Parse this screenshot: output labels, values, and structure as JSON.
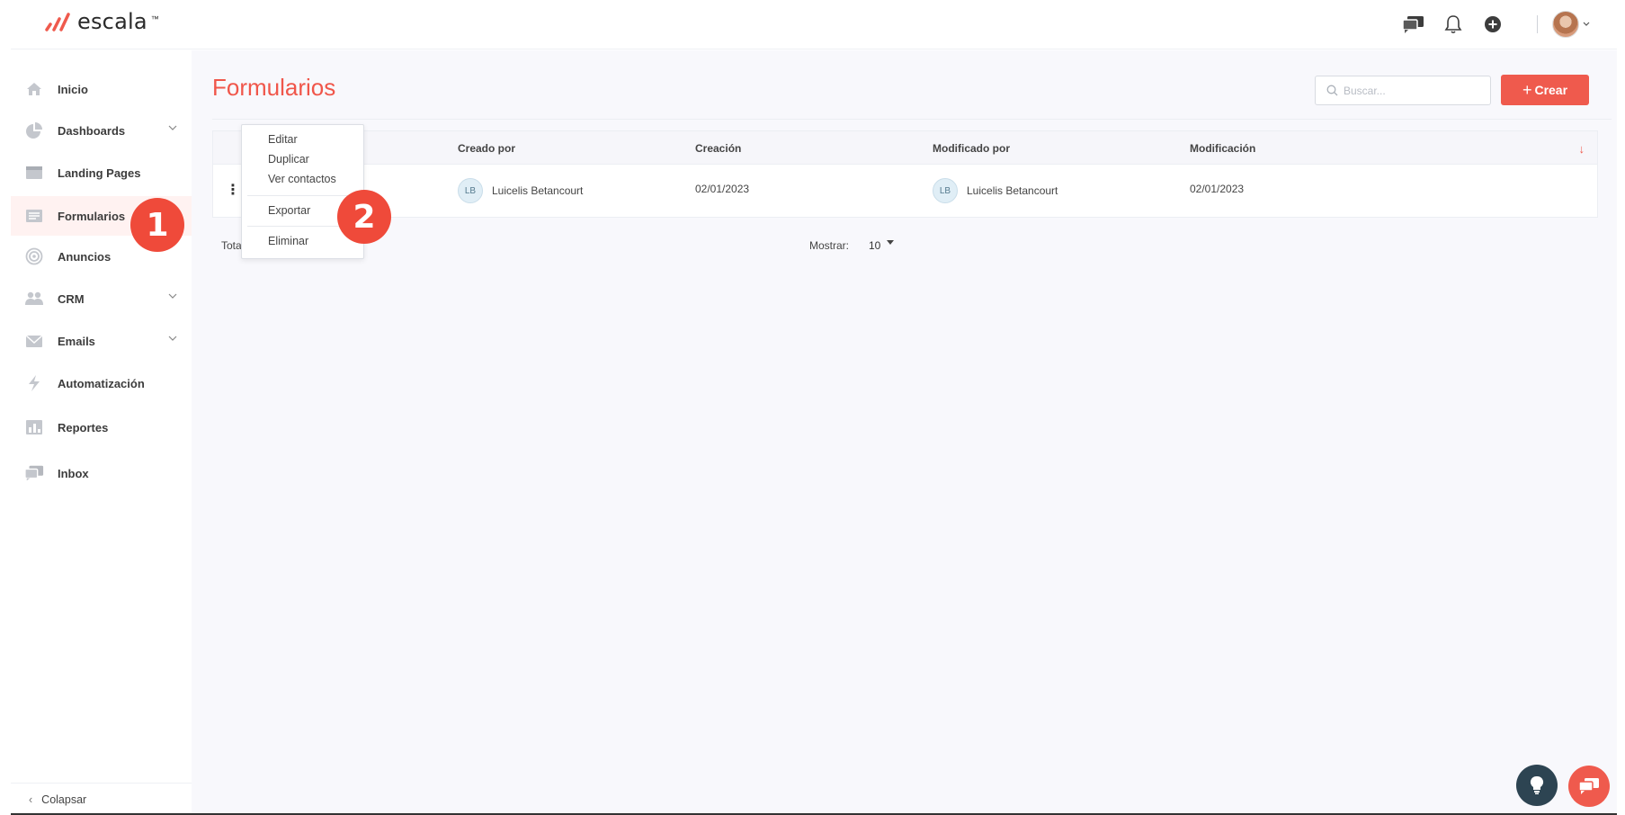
{
  "brand": {
    "name": "escala",
    "tm": "™",
    "accent": "#ef5a4d"
  },
  "header": {
    "icons": [
      "chat-bubbles-icon",
      "bell-icon",
      "plus-circle-icon",
      "avatar"
    ]
  },
  "sidebar": {
    "items": [
      {
        "label": "Inicio",
        "icon": "home-icon",
        "has_children": false
      },
      {
        "label": "Dashboards",
        "icon": "pie-chart-icon",
        "has_children": true
      },
      {
        "label": "Landing Pages",
        "icon": "browser-window-icon",
        "has_children": false
      },
      {
        "label": "Formularios",
        "icon": "form-icon",
        "has_children": false,
        "active": true
      },
      {
        "label": "Anuncios",
        "icon": "target-icon",
        "has_children": false
      },
      {
        "label": "CRM",
        "icon": "users-icon",
        "has_children": true
      },
      {
        "label": "Emails",
        "icon": "envelope-icon",
        "has_children": true
      },
      {
        "label": "Automatización",
        "icon": "lightning-icon",
        "has_children": false
      },
      {
        "label": "Reportes",
        "icon": "bar-chart-icon",
        "has_children": false
      },
      {
        "label": "Inbox",
        "icon": "chat-bubbles-icon",
        "has_children": false
      }
    ],
    "collapse_label": "Colapsar"
  },
  "main": {
    "title": "Formularios",
    "search_placeholder": "Buscar...",
    "create_label": "Crear",
    "table": {
      "columns": [
        "Creado por",
        "Creación",
        "Modificado por",
        "Modificación"
      ],
      "rows": [
        {
          "created_by_initials": "LB",
          "created_by": "Luicelis Betancourt",
          "created": "02/01/2023",
          "modified_by_initials": "LB",
          "modified_by": "Luicelis Betancourt",
          "modified": "02/01/2023"
        }
      ]
    },
    "footer": {
      "total_label": "Tota",
      "show_label": "Mostrar:",
      "page_size": "10"
    }
  },
  "row_menu": {
    "items": [
      "Editar",
      "Duplicar",
      "Ver contactos",
      "Exportar",
      "Eliminar"
    ]
  },
  "markers": [
    "1",
    "2"
  ]
}
